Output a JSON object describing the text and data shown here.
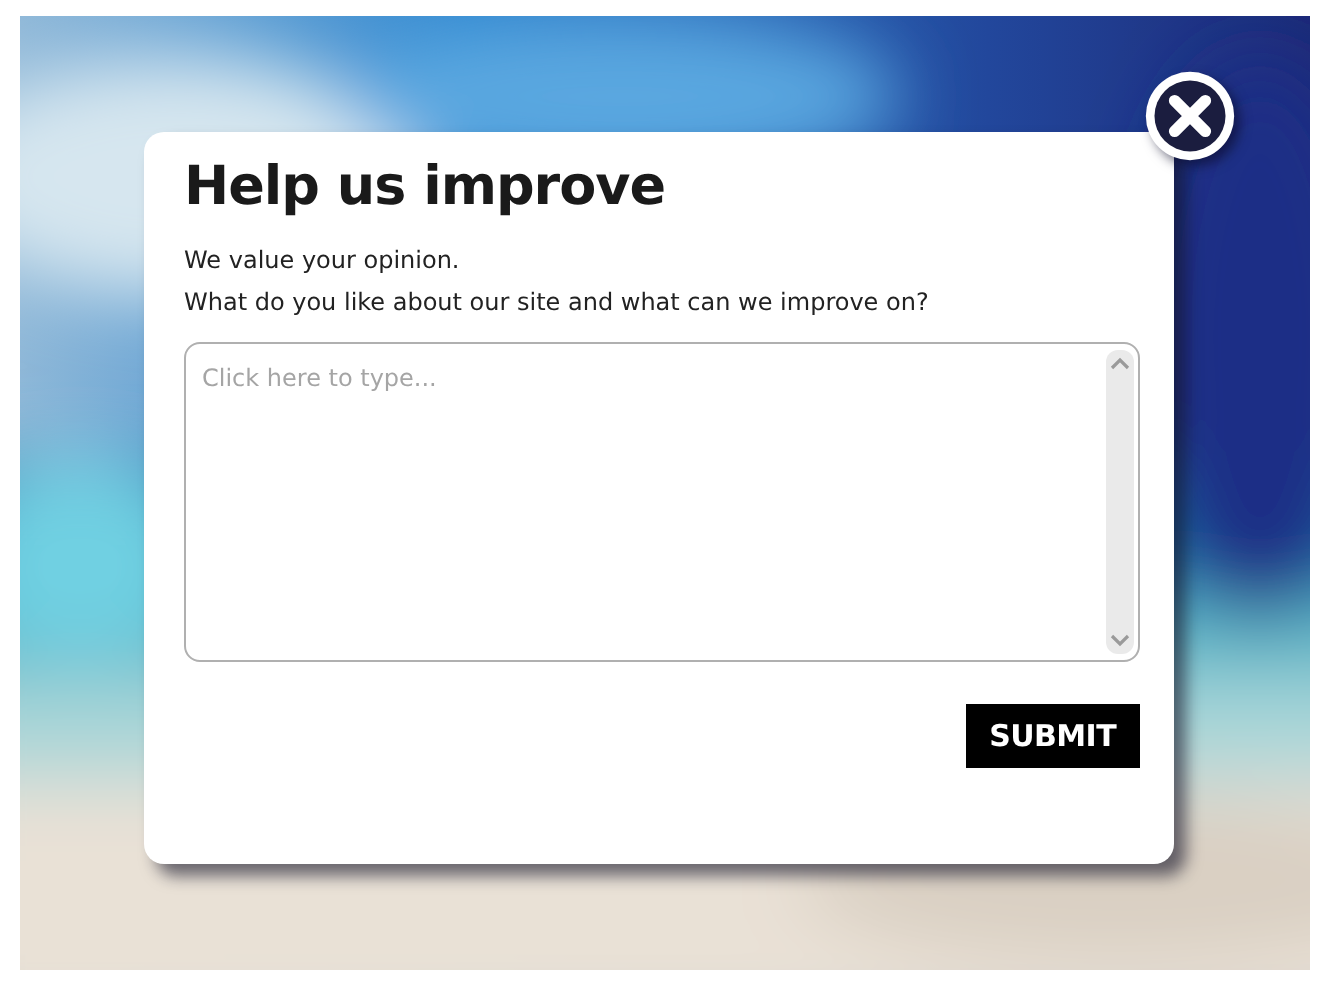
{
  "dialog": {
    "title": "Help us improve",
    "intro_lines": [
      "We value your opinion.",
      "What do you like about our site and what can we improve on?"
    ],
    "feedback_field": {
      "placeholder": "Click here to type..."
    },
    "submit_button": "SUBMIT"
  }
}
